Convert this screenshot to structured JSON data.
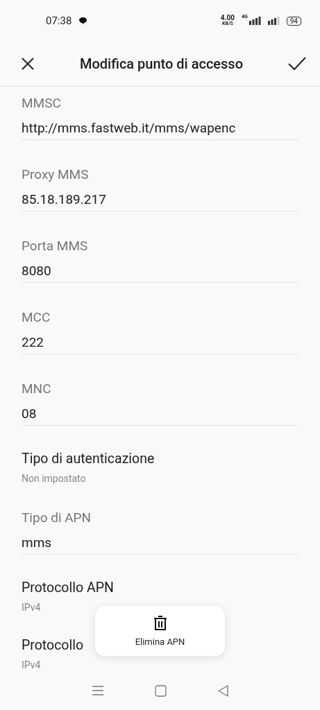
{
  "status_bar": {
    "time": "07:38",
    "speed": "4.00",
    "speed_unit": "KB/S",
    "network": "4G",
    "battery": "94"
  },
  "header": {
    "title": "Modifica punto di accesso"
  },
  "fields": [
    {
      "kind": "input",
      "label": "MMSC",
      "value": "http://mms.fastweb.it/mms/wapenc"
    },
    {
      "kind": "input",
      "label": "Proxy MMS",
      "value": "85.18.189.217"
    },
    {
      "kind": "input",
      "label": "Porta MMS",
      "value": "8080"
    },
    {
      "kind": "input",
      "label": "MCC",
      "value": "222"
    },
    {
      "kind": "input",
      "label": "MNC",
      "value": "08"
    },
    {
      "kind": "select",
      "label": "Tipo di autenticazione",
      "value": "Non impostato"
    },
    {
      "kind": "input",
      "label": "Tipo di APN",
      "value": "mms"
    },
    {
      "kind": "select",
      "label": "Protocollo APN",
      "value": "IPv4"
    },
    {
      "kind": "select",
      "label": "Protocollo",
      "value": "IPv4"
    }
  ],
  "popup": {
    "label": "Elimina APN"
  }
}
